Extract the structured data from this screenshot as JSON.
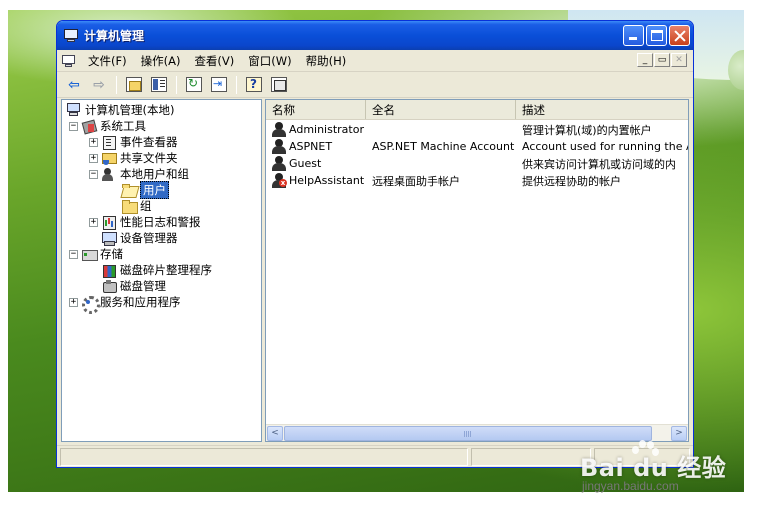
{
  "window": {
    "title": "计算机管理",
    "menus": [
      "文件(F)",
      "操作(A)",
      "查看(V)",
      "窗口(W)",
      "帮助(H)"
    ],
    "mdi_buttons": [
      "_",
      "▭",
      "✕"
    ]
  },
  "toolbar": {
    "icons": [
      "back-arrow-icon",
      "forward-arrow-icon",
      "up-one-level-icon",
      "show-hide-tree-icon",
      "refresh-icon",
      "export-list-icon",
      "help-properties-icon",
      "mmc-icon"
    ]
  },
  "tree": {
    "root": "计算机管理(本地)",
    "system_tools": "系统工具",
    "event_viewer": "事件查看器",
    "shared_folders": "共享文件夹",
    "local_users_groups": "本地用户和组",
    "users": "用户",
    "groups": "组",
    "perf_logs": "性能日志和警报",
    "device_manager": "设备管理器",
    "storage": "存储",
    "defrag": "磁盘碎片整理程序",
    "disk_mgmt": "磁盘管理",
    "services_apps": "服务和应用程序",
    "expand_plus": "+",
    "expand_minus": "−"
  },
  "list": {
    "columns": [
      "名称",
      "全名",
      "描述"
    ],
    "rows": [
      {
        "name": "Administrator",
        "full_name": "",
        "description": "管理计算机(域)的内置帐户",
        "disabled": false
      },
      {
        "name": "ASPNET",
        "full_name": "ASP.NET Machine Account",
        "description": "Account used for running the ASP.I",
        "disabled": false
      },
      {
        "name": "Guest",
        "full_name": "",
        "description": "供来宾访问计算机或访问域的内",
        "disabled": false
      },
      {
        "name": "HelpAssistant",
        "full_name": "远程桌面助手帐户",
        "description": "提供远程协助的帐户",
        "disabled": true
      }
    ]
  },
  "scrollbar": {
    "left": "<",
    "right": ">",
    "grip": "|||"
  },
  "watermark": {
    "logo": "Bai du 经验",
    "url": "jingyan.baidu.com"
  },
  "colors": {
    "titlebar": "#0a4fd8",
    "selection": "#316ac5",
    "window_bg": "#ece9d8"
  }
}
